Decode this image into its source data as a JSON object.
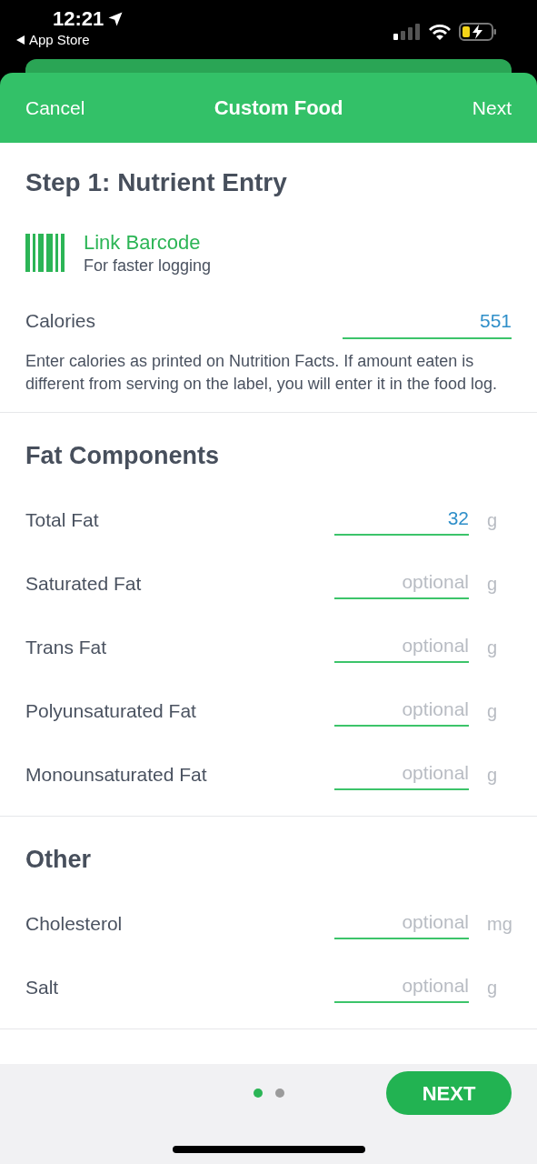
{
  "status_bar": {
    "time": "12:21",
    "back_label": "App Store"
  },
  "nav": {
    "cancel": "Cancel",
    "title": "Custom Food",
    "next": "Next"
  },
  "step_title": "Step 1: Nutrient Entry",
  "barcode": {
    "title": "Link Barcode",
    "subtitle": "For faster logging"
  },
  "calories": {
    "label": "Calories",
    "value": "551"
  },
  "help_text": "Enter calories as printed on Nutrition Facts. If amount eaten is different from serving on the label, you will enter it in the food log.",
  "sections": [
    {
      "title": "Fat Components",
      "rows": [
        {
          "label": "Total Fat",
          "value": "32",
          "unit": "g"
        },
        {
          "label": "Saturated Fat",
          "placeholder": "optional",
          "unit": "g"
        },
        {
          "label": "Trans Fat",
          "placeholder": "optional",
          "unit": "g"
        },
        {
          "label": "Polyunsaturated Fat",
          "placeholder": "optional",
          "unit": "g"
        },
        {
          "label": "Monounsaturated Fat",
          "placeholder": "optional",
          "unit": "g"
        }
      ]
    },
    {
      "title": "Other",
      "rows": [
        {
          "label": "Cholesterol",
          "placeholder": "optional",
          "unit": "mg"
        },
        {
          "label": "Salt",
          "placeholder": "optional",
          "unit": "g"
        }
      ]
    }
  ],
  "pager": [
    {
      "selected": true
    },
    {
      "selected": false
    }
  ],
  "next_button": "NEXT"
}
